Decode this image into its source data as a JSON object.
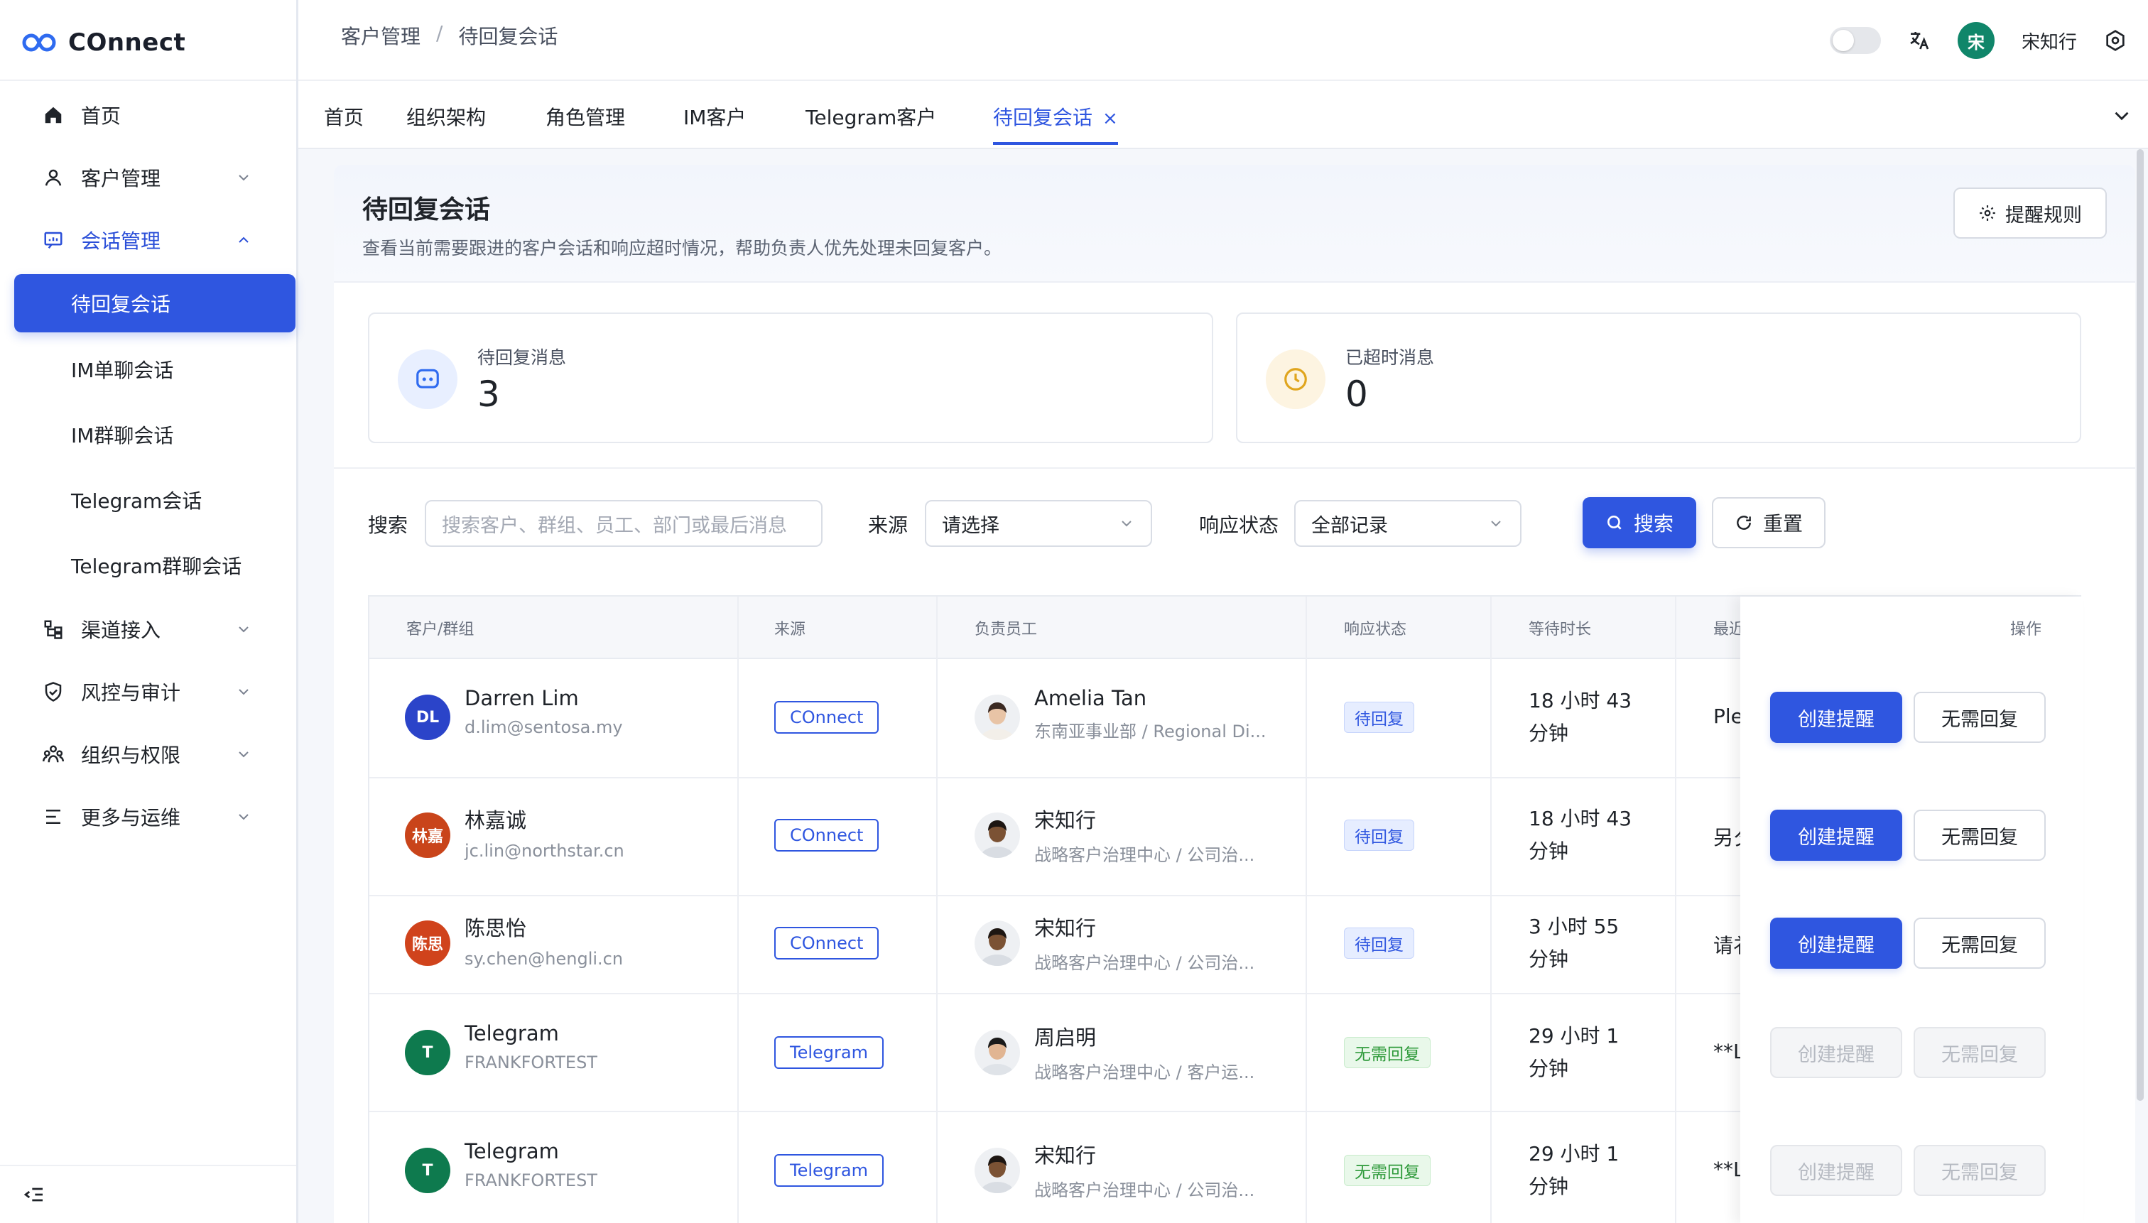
{
  "app": {
    "name": "COnnect"
  },
  "sidebar": {
    "items": [
      {
        "label": "首页"
      },
      {
        "label": "客户管理"
      },
      {
        "label": "会话管理"
      },
      {
        "label": "渠道接入"
      },
      {
        "label": "风控与审计"
      },
      {
        "label": "组织与权限"
      },
      {
        "label": "更多与运维"
      }
    ],
    "sub_items": [
      {
        "label": "待回复会话",
        "active": true
      },
      {
        "label": "IM单聊会话"
      },
      {
        "label": "IM群聊会话"
      },
      {
        "label": "Telegram会话"
      },
      {
        "label": "Telegram群聊会话"
      }
    ]
  },
  "header": {
    "breadcrumb": [
      "客户管理",
      "待回复会话"
    ],
    "breadcrumb_sep": "/",
    "user_avatar": "宋",
    "user_name": "宋知行"
  },
  "tabs": [
    {
      "label": "首页"
    },
    {
      "label": "组织架构"
    },
    {
      "label": "角色管理"
    },
    {
      "label": "IM客户"
    },
    {
      "label": "Telegram客户"
    },
    {
      "label": "待回复会话",
      "active": true,
      "close": "×"
    }
  ],
  "page": {
    "title": "待回复会话",
    "description": "查看当前需要跟进的客户会话和响应超时情况，帮助负责人优先处理未回复客户。",
    "rule_button": "提醒规则"
  },
  "stats": [
    {
      "label": "待回复消息",
      "value": "3"
    },
    {
      "label": "已超时消息",
      "value": "0"
    }
  ],
  "filters": {
    "search_label": "搜索",
    "search_placeholder": "搜索客户、群组、员工、部门或最后消息",
    "source_label": "来源",
    "source_value": "请选择",
    "status_label": "响应状态",
    "status_value": "全部记录",
    "search_button": "搜索",
    "reset_button": "重置"
  },
  "table": {
    "columns": [
      "客户/群组",
      "来源",
      "负责员工",
      "响应状态",
      "等待时长",
      "最近",
      "操作"
    ],
    "rows": [
      {
        "avatar": "DL",
        "avatar_color": "#2b44c9",
        "customer": "Darren Lim",
        "customer_sub": "d.lim@sentosa.my",
        "source": "COnnect",
        "employee": "Amelia Tan",
        "employee_sub": "东南亚事业部 / Regional Di...",
        "status": "待回复",
        "status_kind": "pending",
        "wait_line1": "18 小时 43",
        "wait_line2": "分钟",
        "last": "Ple",
        "op_remind": "创建提醒",
        "op_skip": "无需回复",
        "ops_enabled": true
      },
      {
        "avatar": "林嘉",
        "avatar_color": "#c9441a",
        "customer": "林嘉诚",
        "customer_sub": "jc.lin@northstar.cn",
        "source": "COnnect",
        "employee": "宋知行",
        "employee_sub": "战略客户治理中心 / 公司治...",
        "status": "待回复",
        "status_kind": "pending",
        "wait_line1": "18 小时 43",
        "wait_line2": "分钟",
        "last": "另夕",
        "op_remind": "创建提醒",
        "op_skip": "无需回复",
        "ops_enabled": true
      },
      {
        "avatar": "陈思",
        "avatar_color": "#d0431c",
        "customer": "陈思怡",
        "customer_sub": "sy.chen@hengli.cn",
        "source": "COnnect",
        "employee": "宋知行",
        "employee_sub": "战略客户治理中心 / 公司治...",
        "status": "待回复",
        "status_kind": "pending",
        "wait_line1": "3 小时 55",
        "wait_line2": "分钟",
        "last": "请衤",
        "op_remind": "创建提醒",
        "op_skip": "无需回复",
        "ops_enabled": true
      },
      {
        "avatar": "T",
        "avatar_color": "#0e7a4e",
        "customer": "Telegram",
        "customer_sub": "FRANKFORTEST",
        "source": "Telegram",
        "employee": "周启明",
        "employee_sub": "战略客户治理中心 / 客户运...",
        "status": "无需回复",
        "status_kind": "done",
        "wait_line1": "29 小时 1",
        "wait_line2": "分钟",
        "last": "**L",
        "op_remind": "创建提醒",
        "op_skip": "无需回复",
        "ops_enabled": false
      },
      {
        "avatar": "T",
        "avatar_color": "#0e7a4e",
        "customer": "Telegram",
        "customer_sub": "FRANKFORTEST",
        "source": "Telegram",
        "employee": "宋知行",
        "employee_sub": "战略客户治理中心 / 公司治...",
        "status": "无需回复",
        "status_kind": "done",
        "wait_line1": "29 小时 1",
        "wait_line2": "分钟",
        "last": "**L",
        "op_remind": "创建提醒",
        "op_skip": "无需回复",
        "ops_enabled": false
      }
    ]
  },
  "colors": {
    "primary": "#2f56e0",
    "success": "#2e9a3a",
    "warning": "#e0a51d"
  }
}
